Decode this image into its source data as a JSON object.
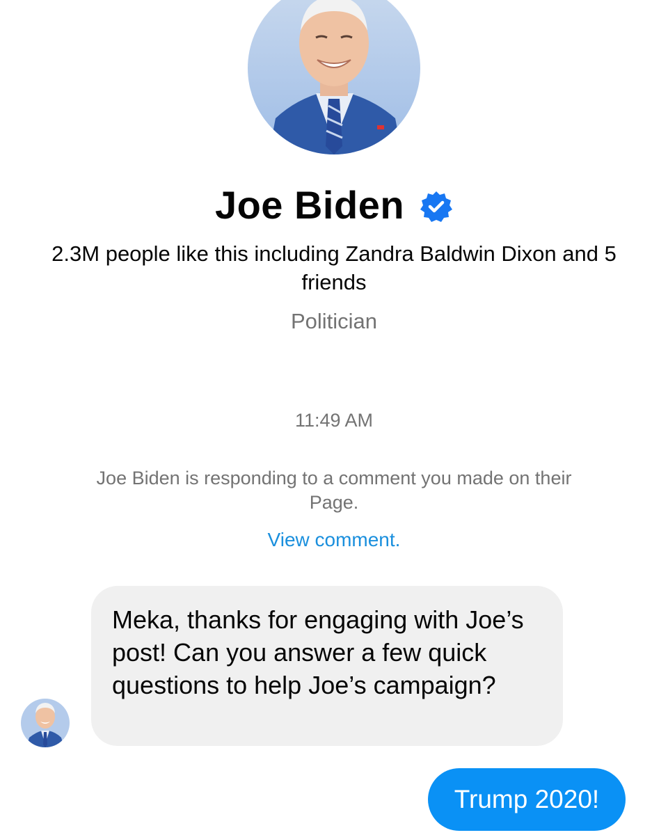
{
  "profile": {
    "name": "Joe Biden",
    "verified": true,
    "likes_text": "2.3M people like this including Zandra Baldwin Dixon and 5 friends",
    "category": "Politician"
  },
  "conversation": {
    "timestamp": "11:49 AM",
    "notice": "Joe Biden is responding to a comment you made on their Page.",
    "view_comment_link": "View comment.",
    "messages": [
      {
        "direction": "incoming",
        "text": "Meka, thanks for engaging with Joe’s post! Can you answer a few quick questions to help Joe’s campaign?"
      },
      {
        "direction": "outgoing",
        "text": "Trump 2020!"
      }
    ]
  },
  "colors": {
    "accent_blue": "#0a91f5",
    "link_blue": "#1a8fdd",
    "verified_blue": "#1877f2",
    "incoming_bubble": "#f0f0f0",
    "secondary_text": "#737373"
  }
}
